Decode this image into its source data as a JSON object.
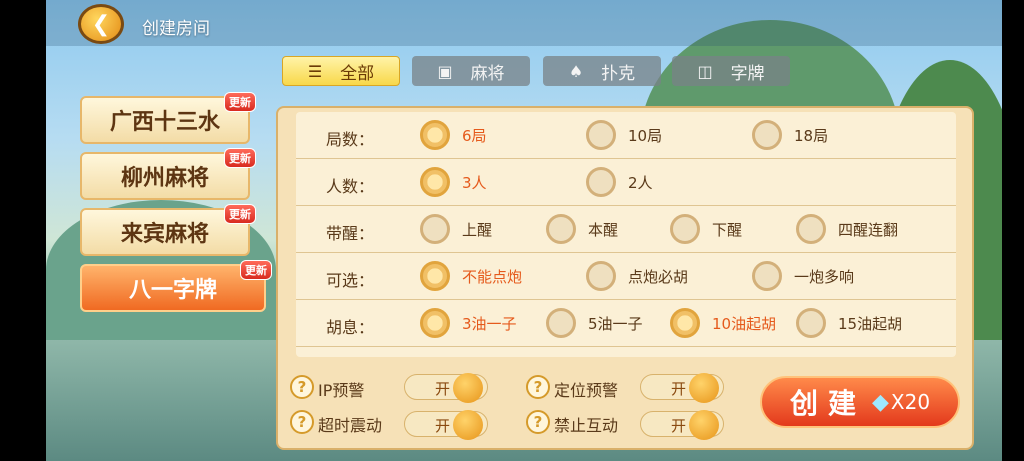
{
  "header": {
    "title": "创建房间",
    "back_icon": "back-arrow-icon"
  },
  "tabs": [
    {
      "label": "全部",
      "icon": "list-icon",
      "selected": true
    },
    {
      "label": "麻将",
      "icon": "mahjong-tile-icon",
      "selected": false
    },
    {
      "label": "扑克",
      "icon": "poker-card-icon",
      "selected": false
    },
    {
      "label": "字牌",
      "icon": "word-card-icon",
      "selected": false
    }
  ],
  "games": [
    {
      "name": "广西十三水",
      "badge": "更新",
      "selected": false
    },
    {
      "name": "柳州麻将",
      "badge": "更新",
      "selected": false
    },
    {
      "name": "来宾麻将",
      "badge": "更新",
      "selected": false
    },
    {
      "name": "八一字牌",
      "badge": "更新",
      "selected": true
    }
  ],
  "options": [
    {
      "label": "局数：",
      "choices": [
        {
          "text": "6局",
          "on": true
        },
        {
          "text": "10局",
          "on": false
        },
        {
          "text": "18局",
          "on": false
        }
      ]
    },
    {
      "label": "人数：",
      "choices": [
        {
          "text": "3人",
          "on": true
        },
        {
          "text": "2人",
          "on": false
        }
      ]
    },
    {
      "label": "带醒：",
      "choices": [
        {
          "text": "上醒",
          "on": false
        },
        {
          "text": "本醒",
          "on": false
        },
        {
          "text": "下醒",
          "on": false
        },
        {
          "text": "四醒连翻",
          "on": false
        }
      ]
    },
    {
      "label": "可选：",
      "choices": [
        {
          "text": "不能点炮",
          "on": true
        },
        {
          "text": "点炮必胡",
          "on": false
        },
        {
          "text": "一炮多响",
          "on": false
        }
      ]
    },
    {
      "label": "胡息：",
      "choices": [
        {
          "text": "3油一子",
          "on": true
        },
        {
          "text": "5油一子",
          "on": false
        },
        {
          "text": "10油起胡",
          "on": true
        },
        {
          "text": "15油起胡",
          "on": false
        }
      ]
    }
  ],
  "toggles": [
    {
      "label": "IP预警",
      "state": "开",
      "help": "?"
    },
    {
      "label": "定位预警",
      "state": "开",
      "help": "?"
    },
    {
      "label": "超时震动",
      "state": "开",
      "help": "?"
    },
    {
      "label": "禁止互动",
      "state": "开",
      "help": "?"
    }
  ],
  "create": {
    "label": "创建",
    "gem_icon": "diamond-icon",
    "cost": "X20"
  },
  "colors": {
    "accent": "#e55a1c",
    "panel": "#f6e1b7",
    "selected_tab": "#f8d84a"
  }
}
